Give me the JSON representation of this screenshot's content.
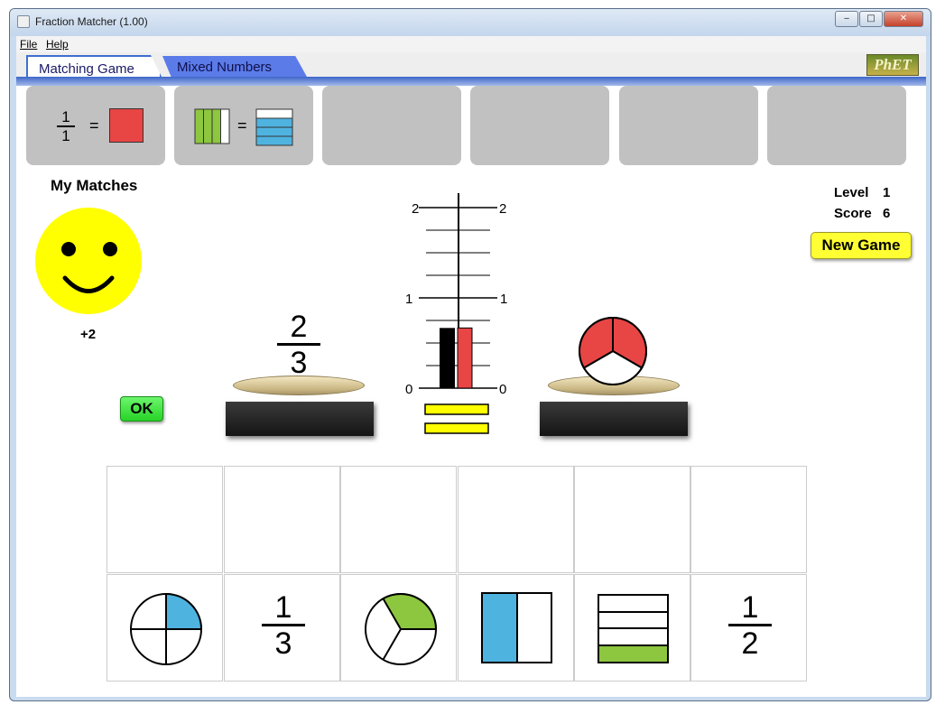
{
  "window": {
    "title": "Fraction Matcher (1.00)",
    "controls": {
      "minimize": "‒",
      "maximize": "□",
      "close": "✕"
    }
  },
  "menu": {
    "items": [
      "File",
      "Help"
    ]
  },
  "tabs": [
    {
      "label": "Matching Game",
      "active": true
    },
    {
      "label": "Mixed Numbers",
      "active": false
    }
  ],
  "logo": {
    "text": "PhET"
  },
  "matches": {
    "heading": "My Matches",
    "items": [
      {
        "left": {
          "type": "fraction",
          "numerator": "1",
          "denominator": "1"
        },
        "equals": "=",
        "right": {
          "type": "square",
          "fill": 1,
          "color": "#e84545"
        }
      },
      {
        "left": {
          "type": "vertical-bars",
          "parts": 4,
          "filled": 3,
          "color": "#8dc63f"
        },
        "equals": "=",
        "right": {
          "type": "horizontal-bars",
          "parts": 4,
          "filled": 3,
          "color": "#4fb3e0"
        }
      },
      {
        "empty": true
      },
      {
        "empty": true
      },
      {
        "empty": true
      },
      {
        "empty": true
      }
    ]
  },
  "feedback": {
    "face": "smiley-face",
    "points": "+2"
  },
  "status": {
    "level_label": "Level",
    "level": "1",
    "score_label": "Score",
    "score": "6"
  },
  "buttons": {
    "ok": "OK",
    "new_game": "New Game"
  },
  "scale": {
    "left_value": 0.6667,
    "right_value": 0.6667,
    "ticks": {
      "zero": "0",
      "one": "1",
      "two": "2"
    },
    "colors": {
      "left_bar": "#000000",
      "right_bar": "#e84545",
      "indicator": "#ffff00"
    }
  },
  "left_plate": {
    "type": "fraction",
    "numerator": "2",
    "denominator": "3"
  },
  "right_plate": {
    "type": "pie",
    "parts": 3,
    "filled": 2,
    "color": "#e84545"
  },
  "pieces": [
    {
      "type": "pie",
      "parts": 4,
      "filled": 1,
      "color": "#4fb3e0"
    },
    {
      "type": "fraction",
      "numerator": "1",
      "denominator": "3"
    },
    {
      "type": "pie",
      "parts": 3,
      "filled": 1,
      "color": "#8dc63f"
    },
    {
      "type": "vertical-bars",
      "parts": 2,
      "filled": 1,
      "color": "#4fb3e0"
    },
    {
      "type": "horizontal-bars",
      "parts": 4,
      "filled": 1,
      "color": "#8dc63f"
    },
    {
      "type": "fraction",
      "numerator": "1",
      "denominator": "2"
    }
  ]
}
